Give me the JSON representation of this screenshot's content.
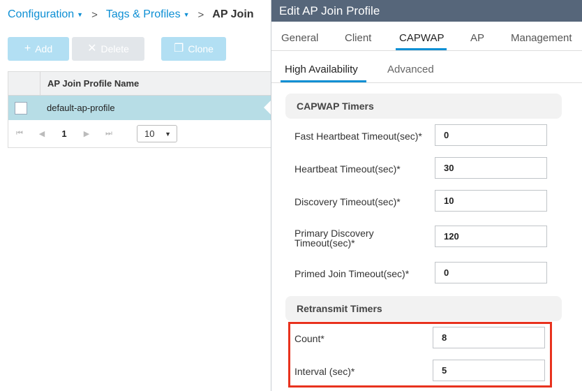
{
  "breadcrumb": {
    "configuration": "Configuration",
    "tags_profiles": "Tags & Profiles",
    "separator": ">",
    "current": "AP Join"
  },
  "toolbar": {
    "add_label": "Add",
    "add_icon": "+",
    "delete_label": "Delete",
    "delete_icon": "✕",
    "clone_label": "Clone",
    "clone_icon": "❐"
  },
  "grid": {
    "column_header": "AP Join Profile Name",
    "rows": [
      {
        "name": "default-ap-profile"
      }
    ],
    "pager": {
      "first": "⏮",
      "prev": "◀",
      "current_page": "1",
      "next": "▶",
      "last": "⏭",
      "page_size": "10"
    }
  },
  "panel": {
    "title": "Edit AP Join Profile",
    "tabs": [
      "General",
      "Client",
      "CAPWAP",
      "AP",
      "Management"
    ],
    "active_tab": "CAPWAP",
    "subtabs": [
      "High Availability",
      "Advanced"
    ],
    "active_subtab": "High Availability"
  },
  "capwap_timers": {
    "heading": "CAPWAP Timers",
    "fast_heartbeat": {
      "label": "Fast Heartbeat Timeout(sec)*",
      "value": "0"
    },
    "heartbeat": {
      "label": "Heartbeat Timeout(sec)*",
      "value": "30"
    },
    "discovery": {
      "label": "Discovery Timeout(sec)*",
      "value": "10"
    },
    "primary_discovery": {
      "label_line1": "Primary Discovery",
      "label_line2": "Timeout(sec)*",
      "value": "120"
    },
    "primed_join": {
      "label": "Primed Join Timeout(sec)*",
      "value": "0"
    }
  },
  "retransmit_timers": {
    "heading": "Retransmit Timers",
    "count": {
      "label": "Count*",
      "value": "8"
    },
    "interval": {
      "label": "Interval (sec)*",
      "value": "5"
    }
  },
  "colors": {
    "accent": "#0d8fd4",
    "header_bg": "#56667a",
    "selected_row": "#b7dde6",
    "highlight": "#e8321e"
  }
}
